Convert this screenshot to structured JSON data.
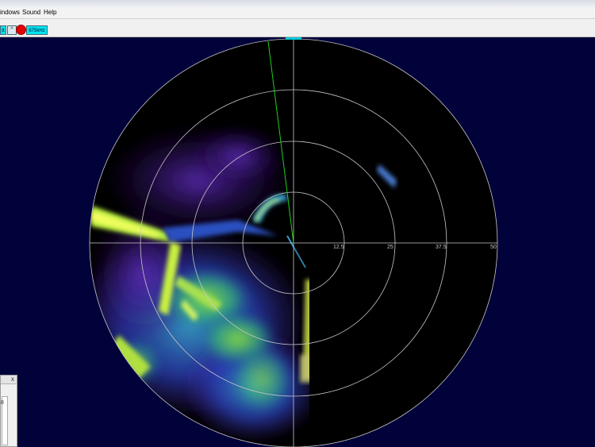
{
  "menu": {
    "items": [
      {
        "label": "indows"
      },
      {
        "label": "Sound"
      },
      {
        "label": "Help"
      }
    ]
  },
  "toolbar": {
    "left_label": "tt",
    "arrow": "^",
    "freq_label": "675kHz"
  },
  "sonar": {
    "range_labels": [
      "12.5",
      "25",
      "37.5",
      "50"
    ]
  },
  "mini_panel": {
    "close": "x",
    "value": "8"
  },
  "colors": {
    "background": "#02023a",
    "scope": "#000000",
    "grid": "#c8c8c8",
    "sweep": "#1fcf1f",
    "accent": "#00e5ee",
    "record": "#e30000"
  }
}
